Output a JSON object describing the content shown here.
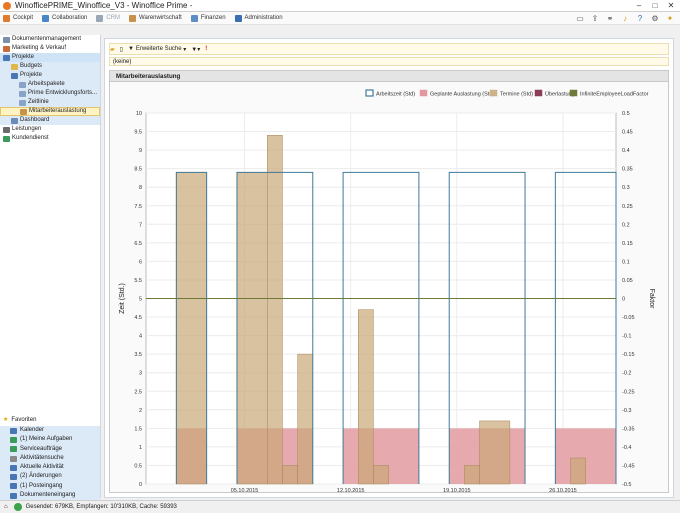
{
  "window": {
    "title": "WinofficePRIME_Winoffice_V3 - Winoffice Prime -",
    "controls": [
      "–",
      "□",
      "✕"
    ]
  },
  "menubar": {
    "items": [
      {
        "label": "Cockpit",
        "color": "#e07b2b"
      },
      {
        "label": "Collaboration",
        "color": "#4a87c8"
      },
      {
        "label": "CRM",
        "color": "#9aa7b5"
      },
      {
        "label": "Warenwirtschaft",
        "color": "#c8924a"
      },
      {
        "label": "Finanzen",
        "color": "#5b8fc6"
      },
      {
        "label": "Administration",
        "color": "#3a6fb0"
      }
    ],
    "right_icons": [
      "window-icon",
      "export-icon",
      "link-icon",
      "bell-icon",
      "help-icon",
      "gear-icon",
      "pin-icon"
    ]
  },
  "sidebar": {
    "items": [
      {
        "label": "Dokumentenmanagement",
        "level": 0,
        "icon_color": "#7a8fa8",
        "state": ""
      },
      {
        "label": "Marketing & Verkauf",
        "level": 0,
        "icon_color": "#c96a3a",
        "state": ""
      },
      {
        "label": "Projekte",
        "level": 0,
        "icon_color": "#4a77b4",
        "state": "sel"
      },
      {
        "label": "Budgets",
        "level": 1,
        "icon_color": "#e0b84a",
        "state": "sub"
      },
      {
        "label": "Projekte",
        "level": 1,
        "icon_color": "#4a77b4",
        "state": "sub"
      },
      {
        "label": "Arbeitspakete",
        "level": 2,
        "icon_color": "#8aa4c8",
        "state": "sub"
      },
      {
        "label": "Prime Entwicklungsforts...",
        "level": 2,
        "icon_color": "#8aa4c8",
        "state": "sub"
      },
      {
        "label": "Zeitlinie",
        "level": 2,
        "icon_color": "#8aa4c8",
        "state": "sub"
      },
      {
        "label": "Mitarbeiterauslastung",
        "level": 2,
        "icon_color": "#c8924a",
        "state": "hl"
      },
      {
        "label": "Dashboard",
        "level": 1,
        "icon_color": "#6b8bb8",
        "state": "sub"
      },
      {
        "label": "Leistungen",
        "level": 0,
        "icon_color": "#6b6b6b",
        "state": ""
      },
      {
        "label": "Kundendienst",
        "level": 0,
        "icon_color": "#3a9b5a",
        "state": ""
      }
    ],
    "favorites_label": "Favoriten",
    "favorites": [
      {
        "label": "Kalender",
        "icon_color": "#4a77b4"
      },
      {
        "label": "(1) Meine Aufgaben",
        "icon_color": "#3a9b5a"
      },
      {
        "label": "Serviceaufträge",
        "icon_color": "#3a9b5a"
      },
      {
        "label": "Aktivitätensuche",
        "icon_color": "#8a8a8a"
      },
      {
        "label": "Aktuelle Aktivität",
        "icon_color": "#4a77b4"
      },
      {
        "label": "(2) Änderungen",
        "icon_color": "#4a77b4"
      },
      {
        "label": "(1) Posteingang",
        "icon_color": "#4a77b4"
      },
      {
        "label": "Dokumenteneingang",
        "icon_color": "#4a77b4"
      }
    ]
  },
  "toolbar": {
    "search_label": "Erweiterte Suche",
    "filter_value": "(keine)"
  },
  "panel": {
    "title": "Mitarbeiterauslastung"
  },
  "chart_data": {
    "type": "bar",
    "legend_position": "top-right",
    "legend": [
      {
        "name": "Arbeitszeit (Std)",
        "color": "#3f7a99",
        "style": "outline"
      },
      {
        "name": "Geplante Auslastung (Std)",
        "color": "#e09a9f",
        "style": "fill"
      },
      {
        "name": "Termine (Std)",
        "color": "#cdb28a",
        "style": "fill"
      },
      {
        "name": "Überlastung",
        "color": "#8c3c56",
        "style": "fill"
      },
      {
        "name": "InfiniteEmployeeLoadFactor",
        "color": "#6f7a3a",
        "style": "fill"
      }
    ],
    "ylabel": "Zeit (Std.)",
    "y2label": "Faktor",
    "ylim": [
      0,
      10
    ],
    "y_ticks": [
      "0",
      "0.5",
      "1",
      "1.5",
      "2",
      "2.5",
      "3",
      "3.5",
      "4",
      "4.5",
      "5",
      "5.5",
      "6",
      "6.5",
      "7",
      "7.5",
      "8",
      "8.5",
      "9",
      "9.5",
      "10"
    ],
    "y2lim": [
      -0.5,
      0.5
    ],
    "y2_ticks": [
      "-0.5",
      "-0.45",
      "-0.4",
      "-0.35",
      "-0.3",
      "-0.25",
      "-0.2",
      "-0.15",
      "-0.1",
      "-0.05",
      "0",
      "0.05",
      "0.1",
      "0.15",
      "0.2",
      "0.25",
      "0.3",
      "0.35",
      "0.4",
      "0.45",
      "0.5"
    ],
    "x_labels": [
      {
        "label": "05.10.2015",
        "day": 6.5
      },
      {
        "label": "12.10.2015",
        "day": 13.5
      },
      {
        "label": "19.10.2015",
        "day": 20.5
      },
      {
        "label": "26.10.2015",
        "day": 27.5
      }
    ],
    "x_range_days": [
      0,
      31
    ],
    "arbeitszeit": [
      {
        "start": 2,
        "end": 4,
        "value": 8.4
      },
      {
        "start": 6,
        "end": 11,
        "value": 8.4
      },
      {
        "start": 13,
        "end": 18,
        "value": 8.4
      },
      {
        "start": 20,
        "end": 25,
        "value": 8.4
      },
      {
        "start": 27,
        "end": 32,
        "value": 8.4
      }
    ],
    "geplante_auslastung": [
      {
        "start": 2,
        "end": 4,
        "value": 1.5
      },
      {
        "start": 6,
        "end": 11,
        "value": 1.5
      },
      {
        "start": 13,
        "end": 18,
        "value": 1.5
      },
      {
        "start": 20,
        "end": 25,
        "value": 1.5
      },
      {
        "start": 27,
        "end": 32,
        "value": 1.5
      }
    ],
    "termine": [
      {
        "start": 2,
        "end": 4,
        "value": 8.4
      },
      {
        "start": 6,
        "end": 8,
        "value": 8.4
      },
      {
        "start": 8,
        "end": 9,
        "value": 9.4
      },
      {
        "start": 9,
        "end": 10,
        "value": 0.5
      },
      {
        "start": 10,
        "end": 11,
        "value": 3.5
      },
      {
        "start": 14,
        "end": 15,
        "value": 4.7
      },
      {
        "start": 15,
        "end": 16,
        "value": 0.5
      },
      {
        "start": 21,
        "end": 22,
        "value": 0.5
      },
      {
        "start": 22,
        "end": 24,
        "value": 1.7
      },
      {
        "start": 28,
        "end": 29,
        "value": 0.7
      }
    ],
    "load_factor": 0
  }
}
